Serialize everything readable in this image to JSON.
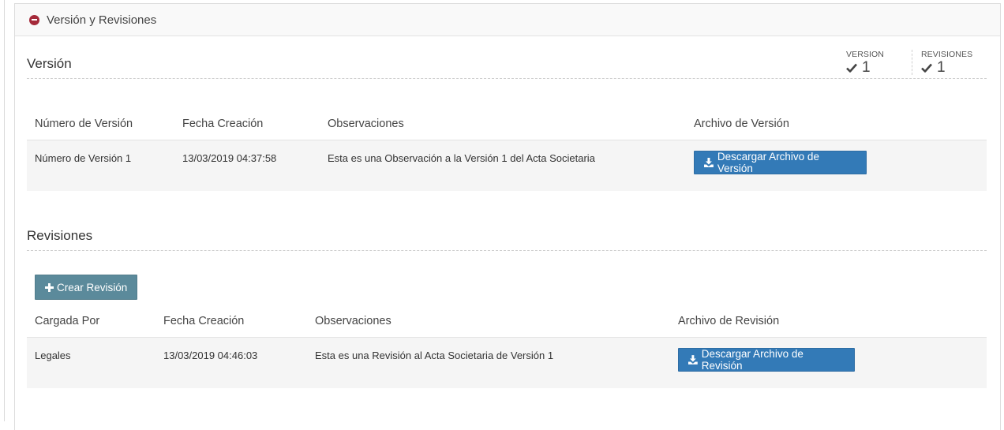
{
  "panel": {
    "title": "Versión y Revisiones"
  },
  "version_section": {
    "title": "Versión",
    "stats": [
      {
        "label": "VERSION",
        "value": "1"
      },
      {
        "label": "REVISIONES",
        "value": "1"
      }
    ],
    "table": {
      "headers": [
        "Número de Versión",
        "Fecha Creación",
        "Observaciones",
        "Archivo de Versión"
      ],
      "rows": [
        {
          "numero": "Número de Versión 1",
          "fecha": "13/03/2019 04:37:58",
          "observaciones": "Esta es una Observación a la Versión 1 del Acta Societaria",
          "button": "Descargar Archivo de Versión"
        }
      ]
    }
  },
  "revisions_section": {
    "title": "Revisiones",
    "create_button": "Crear Revisión",
    "table": {
      "headers": [
        "Cargada Por",
        "Fecha Creación",
        "Observaciones",
        "Archivo de Revisión"
      ],
      "rows": [
        {
          "cargada_por": "Legales",
          "fecha": "13/03/2019 04:46:03",
          "observaciones": "Esta es una Revisión al Acta Societaria de Versión 1",
          "button": "Descargar Archivo de Revisión"
        }
      ]
    }
  },
  "colors": {
    "primary_button": "#337ab7",
    "create_button": "#5b8a9b",
    "collapse_icon": "#a52a3a"
  },
  "icons": {
    "collapse": "minus-circle-icon",
    "check": "check-icon",
    "download": "download-icon",
    "plus": "plus-icon"
  }
}
